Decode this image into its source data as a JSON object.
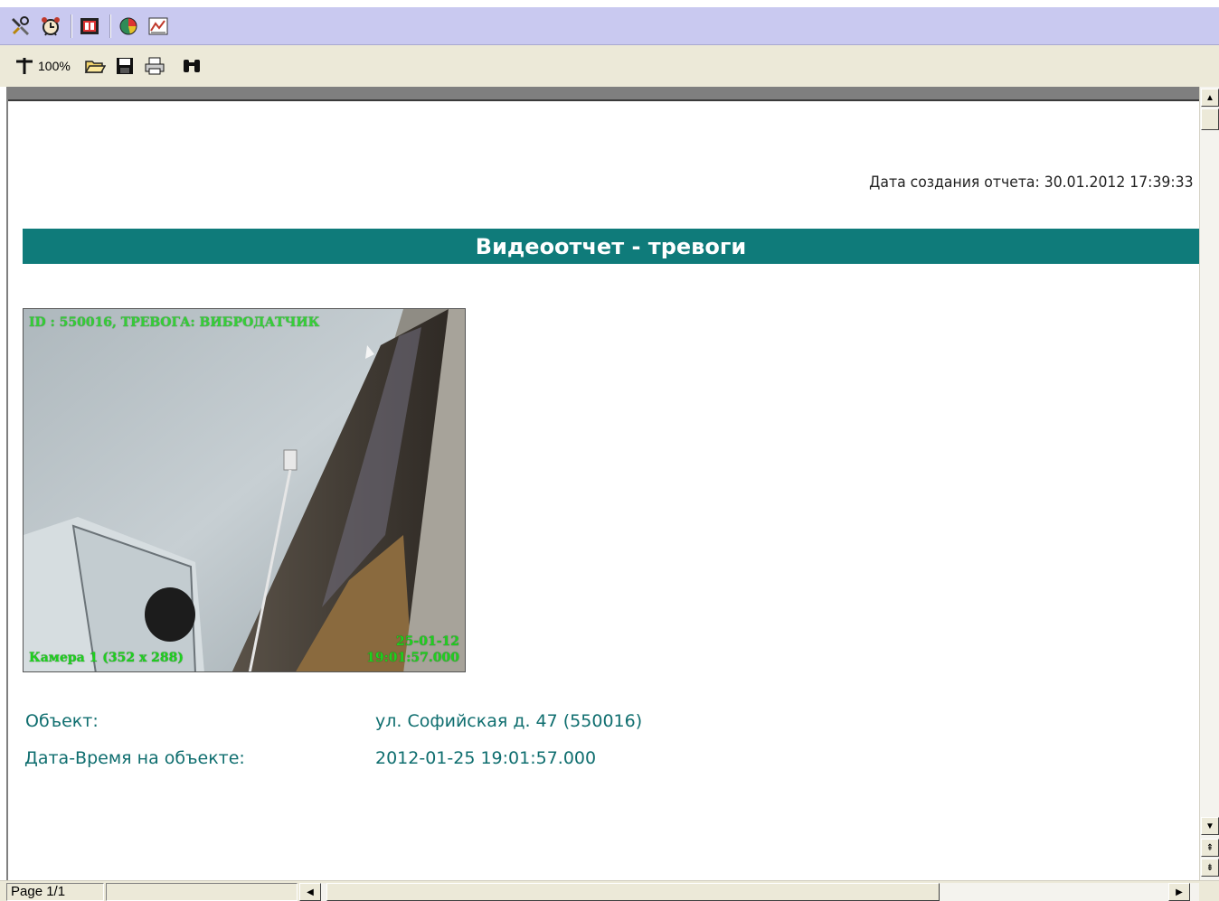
{
  "toolbar_top": {
    "icons": [
      "tools-icon",
      "alarm-clock-icon",
      "film-report-icon",
      "pie-chart-icon",
      "line-chart-icon"
    ]
  },
  "toolbar_viewer": {
    "zoom_label": "100%",
    "icons": [
      "zoom-icon",
      "open-folder-icon",
      "save-icon",
      "print-icon",
      "find-binoculars-icon"
    ]
  },
  "report": {
    "created_text": "Дата создания отчета: 30.01.2012 17:39:33",
    "title": "Видеоотчет - тревоги",
    "snapshot": {
      "osd_top": "ID : 550016, ТРЕВОГА: ВИБРОДАТЧИК",
      "osd_date": "25-01-12",
      "osd_time": "19:01:57.000",
      "osd_camera": "Камера 1 (352 x 288)"
    },
    "fields": [
      {
        "label": "Объект:",
        "value": "ул. Софийская д. 47 (550016)"
      },
      {
        "label": "Дата-Время на объекте:",
        "value": "2012-01-25 19:01:57.000"
      }
    ],
    "colors": {
      "banner": "#0f7b7a",
      "field_text": "#0f6e6f",
      "osd": "#1ed11e"
    }
  },
  "status": {
    "page_label": "Page 1/1"
  }
}
